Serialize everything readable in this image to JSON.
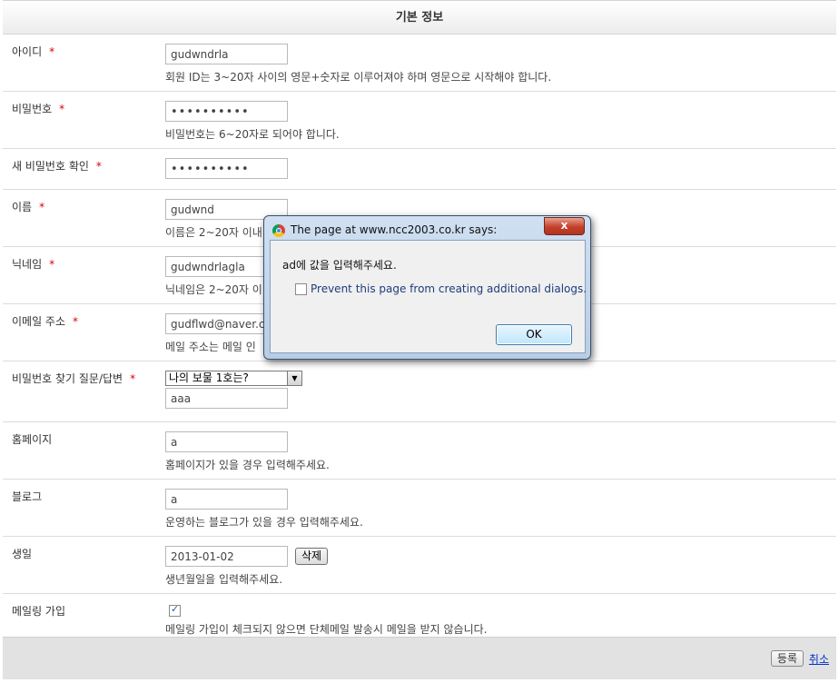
{
  "form": {
    "header": "기본 정보",
    "required_mark": "*",
    "rows": [
      {
        "label": "아이디",
        "required": true,
        "value": "gudwndrla",
        "help": "회원 ID는 3~20자 사이의 영문+숫자로 이루어져야 하며 영문으로 시작해야 합니다."
      },
      {
        "label": "비밀번호",
        "required": true,
        "value": "••••••••••",
        "help": "비밀번호는 6~20자로 되어야 합니다."
      },
      {
        "label": "새 비밀번호 확인",
        "required": true,
        "value": "••••••••••",
        "help": ""
      },
      {
        "label": "이름",
        "required": true,
        "value": "gudwnd",
        "help": "이름은 2~20자 이내"
      },
      {
        "label": "닉네임",
        "required": true,
        "value": "gudwndrlagla",
        "help": "닉네임은 2~20자 이"
      },
      {
        "label": "이메일 주소",
        "required": true,
        "value": "gudflwd@naver.co",
        "help": "메일 주소는 메일 인"
      },
      {
        "label": "비밀번호 찾기 질문/답변",
        "required": true,
        "select_value": "나의 보물 1호는?",
        "value": "aaa",
        "help": ""
      },
      {
        "label": "홈페이지",
        "required": false,
        "value": "a",
        "help": "홈페이지가 있을 경우 입력해주세요."
      },
      {
        "label": "블로그",
        "required": false,
        "value": "a",
        "help": "운영하는 블로그가 있을 경우 입력해주세요."
      },
      {
        "label": "생일",
        "required": false,
        "value": "2013-01-02",
        "button": "삭제",
        "help": "생년월일을 입력해주세요."
      },
      {
        "label": "메일링 가입",
        "required": false,
        "checked": true,
        "help": "메일링 가입이 체크되지 않으면 단체메일 발송시 메일을 받지 않습니다."
      }
    ]
  },
  "footer": {
    "register_label": "등록",
    "cancel_label": "취소"
  },
  "dialog": {
    "title": "The page at www.ncc2003.co.kr says:",
    "close_label": "x",
    "message": "ad에 값을 입력해주세요.",
    "prevent_label": "Prevent this page from creating additional dialogs.",
    "ok_label": "OK",
    "icon": "chrome-icon"
  }
}
